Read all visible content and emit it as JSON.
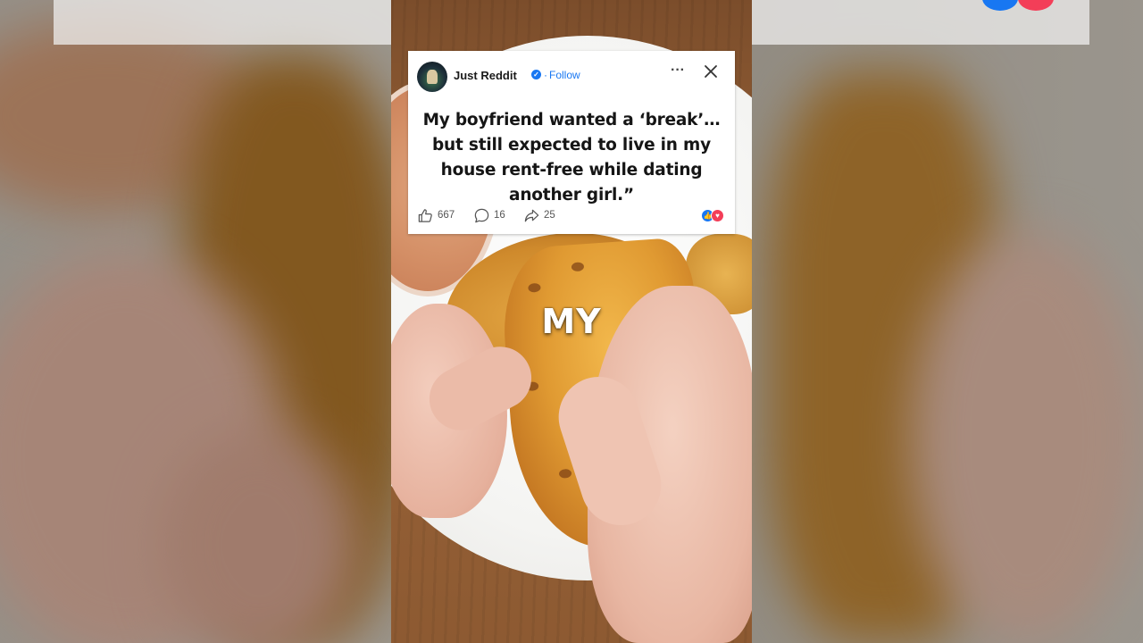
{
  "post": {
    "author": "Just Reddit",
    "separator": "·",
    "follow_label": "Follow",
    "more_label": "···",
    "text": "My boyfriend wanted a ‘break’… but still expected to live in my house rent-free while dating another girl.”",
    "likes": "667",
    "comments": "16",
    "shares": "25"
  },
  "video": {
    "caption": "MY"
  },
  "colors": {
    "facebook_blue": "#1877f2",
    "love_red": "#f33e58",
    "card_bg": "#ffffff"
  },
  "icons": {
    "like": "thumbs-up-icon",
    "comment": "comment-bubble-icon",
    "share": "share-arrow-icon",
    "close": "close-icon",
    "more": "more-dots-icon",
    "verified": "verified-badge-icon"
  }
}
